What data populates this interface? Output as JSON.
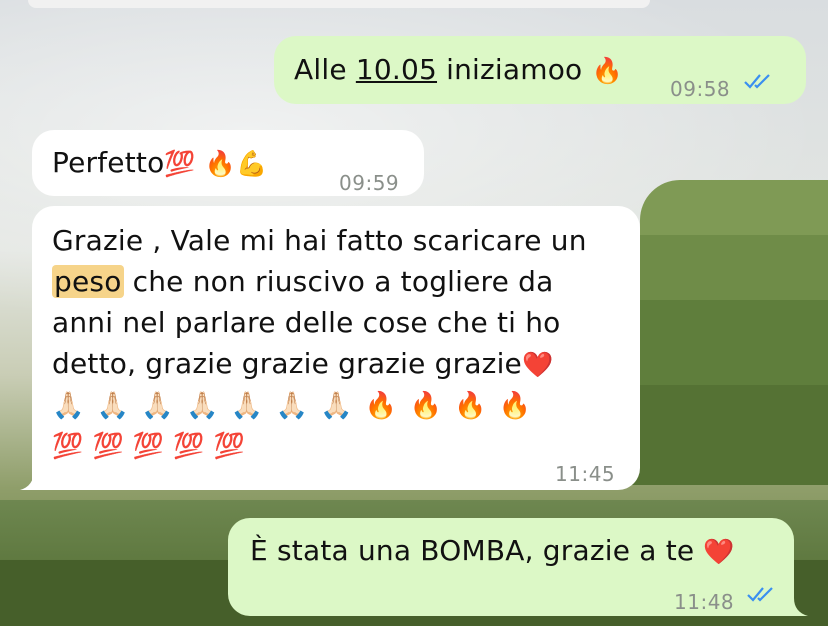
{
  "messages": [
    {
      "direction": "outgoing",
      "text_before": "Alle ",
      "link_text": "10.05",
      "text_after": " iniziamoo ",
      "emoji": "🔥",
      "time": "09:58",
      "status": "read"
    },
    {
      "direction": "incoming",
      "text": "Perfetto",
      "emoji_hundred": "💯",
      "emoji_fire": "🔥",
      "emoji_muscle": "💪",
      "time": "09:59"
    },
    {
      "direction": "incoming",
      "line1": "Grazie , Vale mi hai fatto scaricare un",
      "highlight_word": "peso",
      "line2_rest": " che non riuscivo a togliere da",
      "line3": "anni nel parlare delle cose che ti ho",
      "line4": "detto, grazie grazie grazie grazie",
      "emoji_heart": "❤️",
      "emoji_pray": "🙏🏻",
      "emoji_fire": "🔥",
      "emoji_hundred": "💯",
      "time": "11:45"
    },
    {
      "direction": "outgoing",
      "text": "È stata una BOMBA, grazie a te ",
      "emoji_heart": "❤️",
      "time": "11:48",
      "status": "read"
    }
  ],
  "colors": {
    "outgoing_bubble": "#dcf8c6",
    "incoming_bubble": "#ffffff",
    "read_ticks": "#3a8ff0",
    "timestamp": "#8a8f8a"
  }
}
